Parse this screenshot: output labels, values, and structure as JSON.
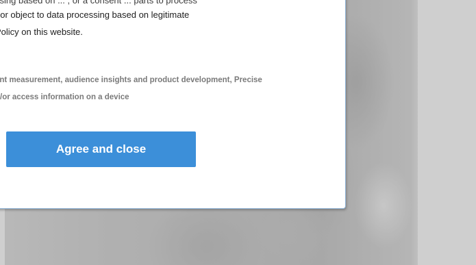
{
  "dialog": {
    "text_lines": [
      "ssing based on ... , or a consent ... parts to process",
      "t or object to data processing based on legitimate",
      "Policy on this website."
    ],
    "purposes_lines": [
      "ent measurement, audience insights and product development, Precise",
      "d/or access information on a device"
    ],
    "agree_button_label": "Agree and close"
  },
  "colors": {
    "button_bg": "#3c8fd9",
    "button_text": "#ffffff",
    "dialog_border": "#8fb4d8",
    "purposes_text": "#7a7a7a"
  }
}
